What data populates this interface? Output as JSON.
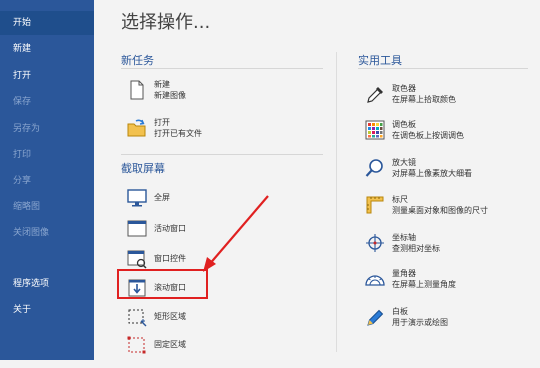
{
  "sidebar": {
    "items": [
      {
        "label": "开始",
        "state": "active"
      },
      {
        "label": "新建",
        "state": "normal"
      },
      {
        "label": "打开",
        "state": "normal"
      },
      {
        "label": "保存",
        "state": "disabled"
      },
      {
        "label": "另存为",
        "state": "disabled"
      },
      {
        "label": "打印",
        "state": "disabled"
      },
      {
        "label": "分享",
        "state": "disabled"
      },
      {
        "label": "缩略图",
        "state": "disabled"
      },
      {
        "label": "关闭图像",
        "state": "disabled"
      },
      {
        "label": "程序选项",
        "state": "normal"
      },
      {
        "label": "关于",
        "state": "normal"
      }
    ]
  },
  "main": {
    "title": "选择操作...",
    "new_task": {
      "heading": "新任务",
      "items": [
        {
          "title": "新建",
          "desc": "新建图像",
          "icon": "new-document-icon"
        },
        {
          "title": "打开",
          "desc": "打开已有文件",
          "icon": "open-folder-icon"
        }
      ]
    },
    "capture": {
      "heading": "截取屏幕",
      "items": [
        {
          "title": "全屏",
          "icon": "monitor-icon"
        },
        {
          "title": "活动窗口",
          "icon": "window-icon"
        },
        {
          "title": "窗口控件",
          "icon": "window-control-icon"
        },
        {
          "title": "滚动窗口",
          "icon": "scroll-window-icon"
        },
        {
          "title": "矩形区域",
          "icon": "rectangle-region-icon"
        },
        {
          "title": "固定区域",
          "icon": "fixed-region-icon"
        }
      ]
    },
    "tools": {
      "heading": "实用工具",
      "items": [
        {
          "title": "取色器",
          "desc": "在屏幕上拾取颜色",
          "icon": "eyedropper-icon"
        },
        {
          "title": "调色板",
          "desc": "在调色板上按调调色",
          "icon": "palette-icon"
        },
        {
          "title": "放大镜",
          "desc": "对屏幕上像素放大细看",
          "icon": "magnifier-icon"
        },
        {
          "title": "标尺",
          "desc": "测量桌面对象和图像的尺寸",
          "icon": "ruler-icon"
        },
        {
          "title": "坐标轴",
          "desc": "查测相对坐标",
          "icon": "crosshair-icon"
        },
        {
          "title": "量角器",
          "desc": "在屏幕上测量角度",
          "icon": "protractor-icon"
        },
        {
          "title": "白板",
          "desc": "用于演示或绘图",
          "icon": "pen-icon"
        }
      ]
    }
  },
  "colors": {
    "sidebar": "#2b579a",
    "accent": "#2b579a",
    "annotation": "#e02020"
  }
}
